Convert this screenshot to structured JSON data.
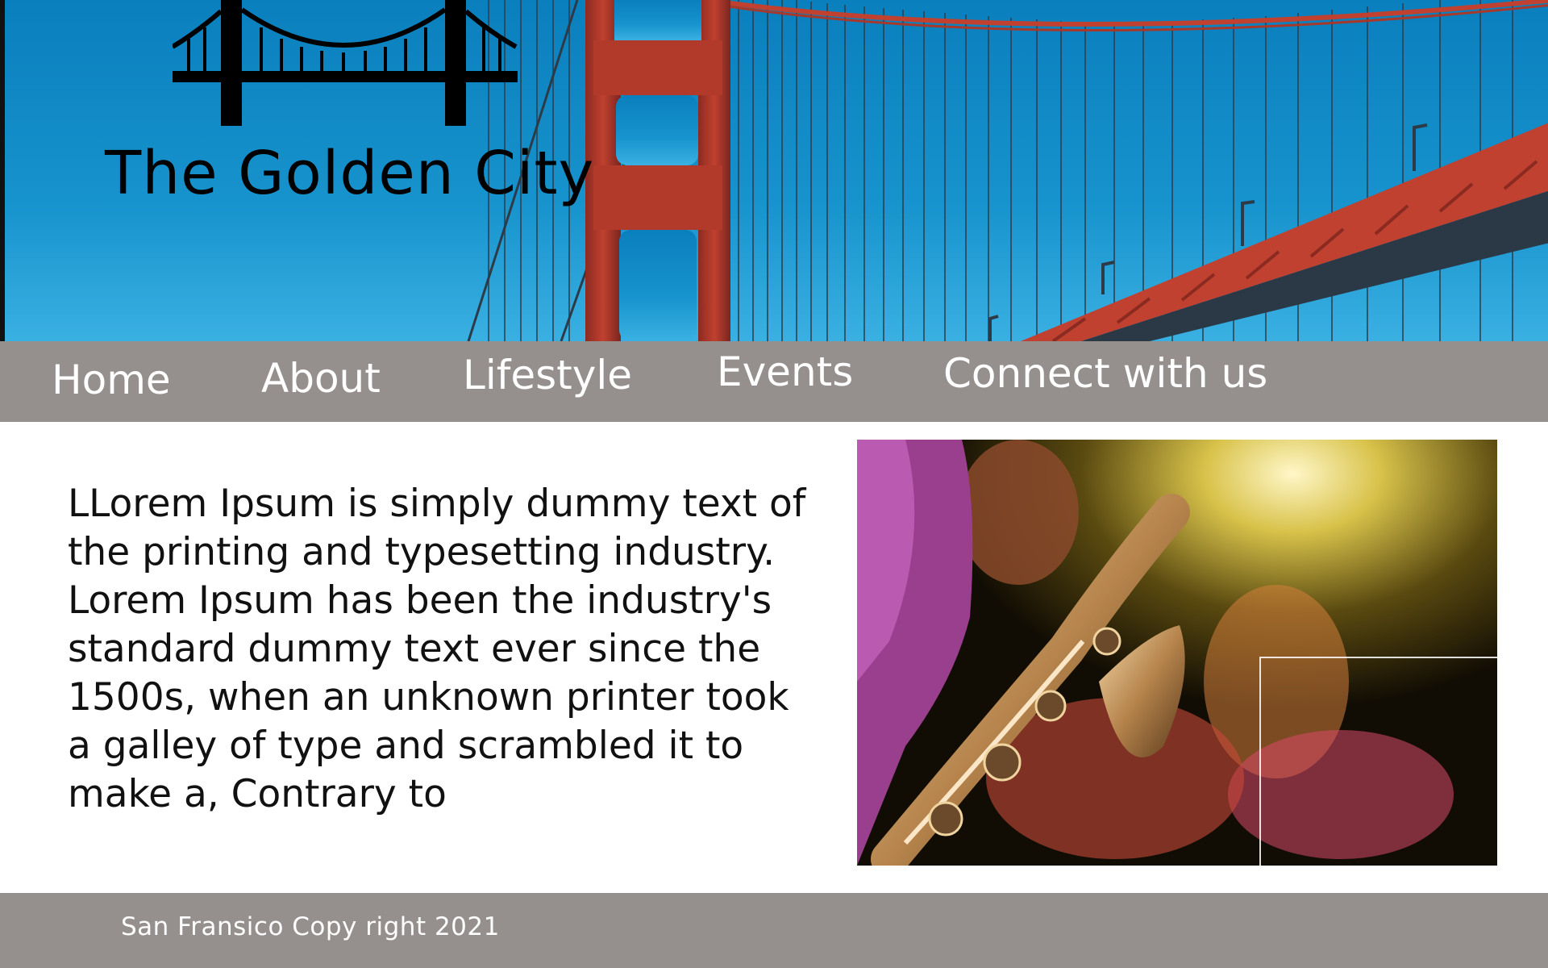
{
  "site": {
    "title": "The Golden City"
  },
  "nav": {
    "items": [
      {
        "label": "Home"
      },
      {
        "label": "About"
      },
      {
        "label": "Lifestyle"
      },
      {
        "label": "Events"
      },
      {
        "label": "Connect with us"
      }
    ]
  },
  "main": {
    "paragraph": "LLorem Ipsum is simply dummy text of the printing and typesetting industry. Lorem Ipsum has been the industry's standard dummy text ever since the 1500s, when an unknown printer took a galley of type and scrambled it to make a, Contrary to"
  },
  "footer": {
    "text": "San Fransico Copy right 2021"
  },
  "icons": {
    "logo": "golden-gate-bridge-icon"
  },
  "colors": {
    "nav_bg": "#958f8e",
    "sky": "#1a8fc9",
    "bridge": "#c0412f"
  }
}
